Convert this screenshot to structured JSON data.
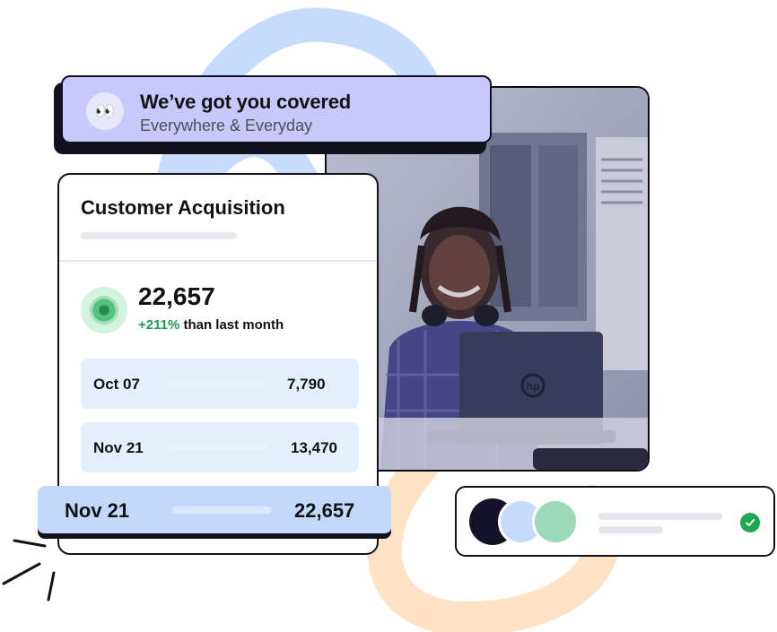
{
  "banner": {
    "emoji": "👀",
    "title": "We’ve got you covered",
    "subtitle": "Everywhere & Everyday"
  },
  "acquisition": {
    "title": "Customer Acquisition",
    "total": "22,657",
    "delta": "+211%",
    "delta_suffix": " than last month",
    "rows": [
      {
        "date": "Oct 07",
        "value": "7,790"
      },
      {
        "date": "Nov 21",
        "value": "13,470"
      }
    ],
    "highlight": {
      "date": "Nov 21",
      "value": "22,657"
    }
  },
  "photo": {
    "laptop_logo": "hp"
  },
  "team": {
    "avatars": [
      "#12122a",
      "#c5dafc",
      "#9cd9b8"
    ],
    "check_color": "#1fa84f"
  },
  "colors": {
    "banner_bg": "#c8c8fb",
    "row_bg": "#e1f0fc",
    "highlight_bg": "#c2d9fc",
    "positive": "#1e9a4e",
    "swirl_blue": "#c7dcfc",
    "swirl_orange": "#fde3c4"
  }
}
